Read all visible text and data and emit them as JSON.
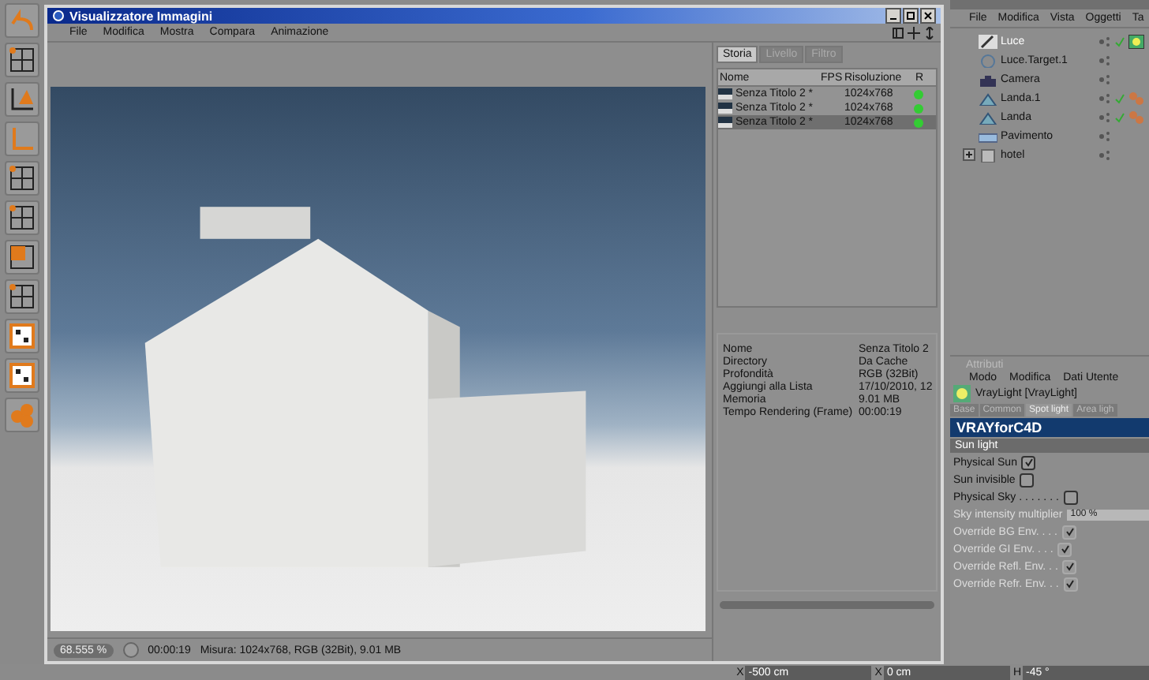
{
  "window": {
    "title": "Visualizzatore Immagini",
    "menu": [
      "File",
      "Modifica",
      "Mostra",
      "Compara",
      "Animazione"
    ]
  },
  "history_panel": {
    "tabs": [
      {
        "label": "Storia",
        "selected": true
      },
      {
        "label": "Livello",
        "selected": false
      },
      {
        "label": "Filtro",
        "selected": false
      }
    ],
    "columns": [
      "Nome",
      "FPS",
      "Risoluzione",
      "R"
    ],
    "rows": [
      {
        "name": "Senza Titolo 2 *",
        "resolution": "1024x768",
        "selected": false
      },
      {
        "name": "Senza Titolo 2 *",
        "resolution": "1024x768",
        "selected": false
      },
      {
        "name": "Senza Titolo 2 *",
        "resolution": "1024x768",
        "selected": true
      }
    ]
  },
  "info": [
    {
      "label": "Nome",
      "value": "Senza Titolo 2"
    },
    {
      "label": "Directory",
      "value": "Da Cache"
    },
    {
      "label": "Profondità",
      "value": "RGB (32Bit)"
    },
    {
      "label": "Aggiungi alla Lista",
      "value": "17/10/2010, 12"
    },
    {
      "label": "Memoria",
      "value": "9.01 MB"
    },
    {
      "label": "Tempo Rendering (Frame)",
      "value": "00:00:19"
    }
  ],
  "status_bar": {
    "zoom": "68.555 %",
    "time": "00:00:19",
    "size": "Misura: 1024x768, RGB (32Bit), 9.01 MB"
  },
  "objects_panel": {
    "menu": [
      "File",
      "Modifica",
      "Vista",
      "Oggetti",
      "Ta"
    ],
    "items": [
      {
        "name": "Luce",
        "kind": "light",
        "selected": true,
        "checked": true,
        "tags": [
          {
            "kind": "vray"
          }
        ]
      },
      {
        "name": "Luce.Target.1",
        "kind": "target",
        "selected": false,
        "checked": false
      },
      {
        "name": "Camera",
        "kind": "camera",
        "selected": false,
        "checked": false
      },
      {
        "name": "Landa.1",
        "kind": "landscape",
        "selected": false,
        "checked": true,
        "tags": [
          {
            "kind": "material"
          }
        ]
      },
      {
        "name": "Landa",
        "kind": "landscape",
        "selected": false,
        "checked": true,
        "tags": [
          {
            "kind": "material"
          }
        ]
      },
      {
        "name": "Pavimento",
        "kind": "floor",
        "selected": false,
        "checked": false
      },
      {
        "name": "hotel",
        "kind": "group",
        "selected": false,
        "checked": false,
        "expanded": false
      }
    ]
  },
  "attributes_panel": {
    "title": "Attributi",
    "menu": [
      "Modo",
      "Modifica",
      "Dati Utente"
    ],
    "object": "VrayLight [VrayLight]",
    "tabs": [
      {
        "label": "Base",
        "selected": false
      },
      {
        "label": "Common",
        "selected": false
      },
      {
        "label": "Spot light",
        "selected": true
      },
      {
        "label": "Area ligh",
        "selected": false
      }
    ],
    "banner": "VRAYforC4D",
    "section": "Sun light",
    "options": [
      {
        "kind": "checkbox",
        "label": "Physical Sun",
        "checked": true,
        "disabled": false
      },
      {
        "kind": "checkbox",
        "label": "Sun invisible",
        "checked": false,
        "disabled": false
      },
      {
        "kind": "checkbox",
        "label": "Physical Sky . . . . . . .",
        "checked": false,
        "disabled": false
      },
      {
        "kind": "slider",
        "label": "Sky intensity multiplier",
        "value": "100 %",
        "level": 1,
        "disabled": true
      },
      {
        "kind": "checkbox",
        "label": "Override BG Env. . . .",
        "checked": true,
        "disabled": true
      },
      {
        "kind": "checkbox",
        "label": "Override GI Env. . . .",
        "checked": true,
        "disabled": true
      },
      {
        "kind": "checkbox",
        "label": "Override Refl. Env. . .",
        "checked": true,
        "disabled": true
      },
      {
        "kind": "checkbox",
        "label": "Override Refr. Env. . .",
        "checked": true,
        "disabled": true
      }
    ]
  },
  "coordinates": [
    {
      "axis": "X",
      "value": "-500 cm"
    },
    {
      "axis": "X",
      "value": "0 cm"
    },
    {
      "axis": "H",
      "value": "-45 °"
    }
  ]
}
